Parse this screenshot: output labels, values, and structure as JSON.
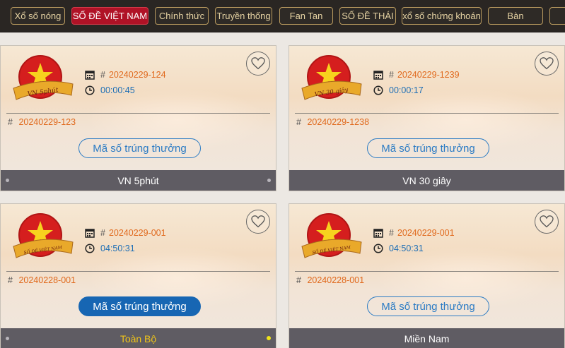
{
  "nav": {
    "items": [
      {
        "label": "Xổ số nóng",
        "active": false
      },
      {
        "label": "SỐ ĐỀ VIỆT NAM",
        "active": true
      },
      {
        "label": "Chính thức",
        "active": false
      },
      {
        "label": "Truyền thống",
        "active": false
      },
      {
        "label": "Fan Tan",
        "active": false
      },
      {
        "label": "SỐ ĐỀ THÁI",
        "active": false
      },
      {
        "label": "xổ số chứng khoán",
        "active": false
      },
      {
        "label": "Bàn",
        "active": false
      }
    ]
  },
  "cards": [
    {
      "emblem_text": "VN 5phút",
      "current_id": "20240229-124",
      "countdown": "00:00:45",
      "previous_id": "20240229-123",
      "button_label": "Mã số trúng thưởng",
      "footer_label": "VN 5phút"
    },
    {
      "emblem_text": "VN 30 giây",
      "current_id": "20240229-1239",
      "countdown": "00:00:17",
      "previous_id": "20240229-1238",
      "button_label": "Mã số trúng thưởng",
      "footer_label": "VN 30 giây"
    },
    {
      "emblem_text": "SỐ ĐỀ VIỆT NAM",
      "current_id": "20240229-001",
      "countdown": "04:50:31",
      "previous_id": "20240228-001",
      "button_label": "Mã số trúng thưởng",
      "footer_label": "Toàn Bộ"
    },
    {
      "emblem_text": "SỐ ĐỀ VIỆT NAM",
      "current_id": "20240229-001",
      "countdown": "04:50:31",
      "previous_id": "20240228-001",
      "button_label": "Mã số trúng thưởng",
      "footer_label": "Miền Nam"
    }
  ],
  "symbols": {
    "hash": "#"
  },
  "colors": {
    "nav_bg": "#2a2623",
    "nav_border": "#b99a5f",
    "nav_active": "#b01226",
    "id_orange": "#e06a1e",
    "time_blue": "#1f6fb5",
    "button_blue": "#1766b3",
    "footer_bg": "#5f5c63",
    "footer_highlight": "#f0c419"
  },
  "icons": [
    "calendar-icon",
    "clock-icon",
    "heart-icon",
    "vietnam-flag-emblem"
  ]
}
